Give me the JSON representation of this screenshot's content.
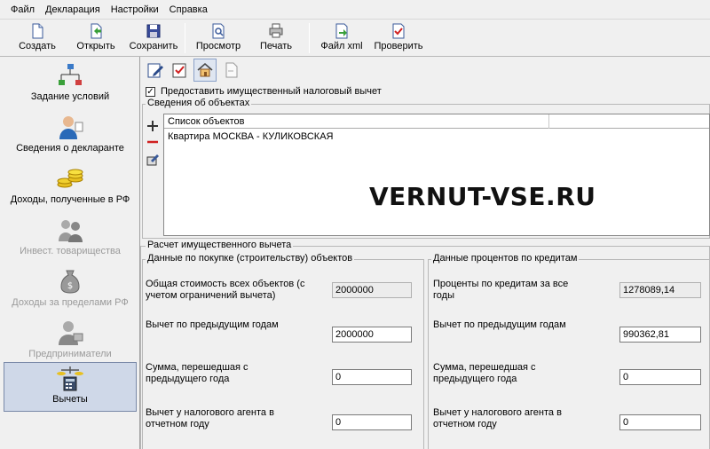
{
  "menu": [
    "Файл",
    "Декларация",
    "Настройки",
    "Справка"
  ],
  "toolbar": {
    "create": "Создать",
    "open": "Открыть",
    "save": "Сохранить",
    "preview": "Просмотр",
    "print": "Печать",
    "xml": "Файл xml",
    "check": "Проверить"
  },
  "sidebar": {
    "items": [
      {
        "label": "Задание условий",
        "enabled": true
      },
      {
        "label": "Сведения о декларанте",
        "enabled": true
      },
      {
        "label": "Доходы, полученные в РФ",
        "enabled": true
      },
      {
        "label": "Инвест. товарищества",
        "enabled": false
      },
      {
        "label": "Доходы за пределами РФ",
        "enabled": false
      },
      {
        "label": "Предприниматели",
        "enabled": false
      },
      {
        "label": "Вычеты",
        "enabled": true,
        "active": true
      }
    ]
  },
  "deduction_checkbox": {
    "label": "Предоставить имущественный налоговый вычет",
    "checked": true
  },
  "objects": {
    "group_title": "Сведения об объектах",
    "column": "Список объектов",
    "rows": [
      "Квартира МОСКВА - КУЛИКОВСКАЯ"
    ]
  },
  "watermark": "VERNUT-VSE.RU",
  "calc": {
    "group_title": "Расчет имущественного вычета",
    "purchase": {
      "title": "Данные по покупке (строительству) объектов",
      "total_cost_label": "Общая стоимость всех объектов (с учетом ограничений вычета)",
      "total_cost_value": "2000000",
      "prev_years_label": "Вычет по предыдущим годам",
      "prev_years_value": "2000000",
      "carried_label": "Сумма, перешедшая с предыдущего года",
      "carried_value": "0",
      "agent_label": "Вычет у налогового агента в отчетном году",
      "agent_value": "0"
    },
    "interest": {
      "title": "Данные процентов по кредитам",
      "total_label": "Проценты по кредитам за все годы",
      "total_value": "1278089,14",
      "prev_years_label": "Вычет по предыдущим годам",
      "prev_years_value": "990362,81",
      "carried_label": "Сумма, перешедшая с предыдущего года",
      "carried_value": "0",
      "agent_label": "Вычет у налогового агента в отчетном году",
      "agent_value": "0"
    }
  }
}
